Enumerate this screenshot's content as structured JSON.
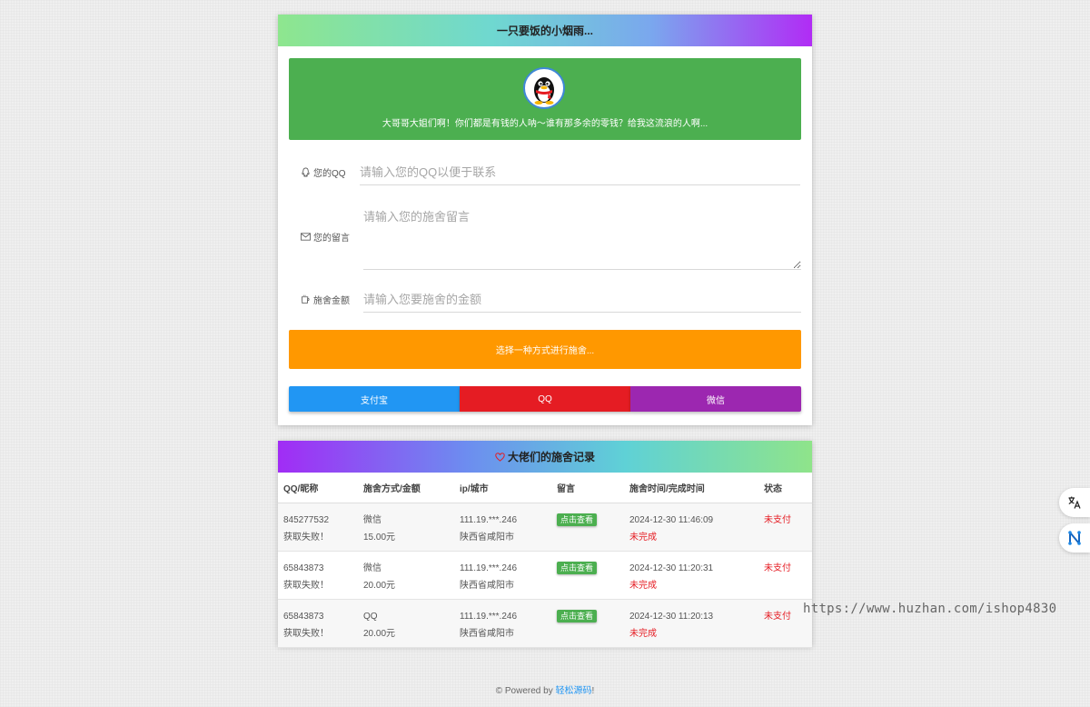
{
  "top_card": {
    "title": "一只要饭的小烟雨...",
    "banner_text": "大哥哥大姐们啊！你们都是有钱的人呐～谁有那多余的零钱？给我这流浪的人啊..."
  },
  "form": {
    "qq_label": "您的QQ",
    "qq_placeholder": "请输入您的QQ以便于联系",
    "message_label": "您的留言",
    "message_placeholder": "请输入您的施舍留言",
    "amount_label": "施舍金额",
    "amount_placeholder": "请输入您要施舍的金额",
    "choose_text": "选择一种方式进行施舍..."
  },
  "payment": {
    "alipay": "支付宝",
    "qq": "QQ",
    "wechat": "微信"
  },
  "records": {
    "title": "大佬们的施舍记录",
    "columns": [
      "QQ/昵称",
      "施舍方式/金额",
      "ip/城市",
      "留言",
      "施舍时间/完成时间",
      "状态"
    ],
    "rows": [
      {
        "qq": "845277532",
        "nick": "获取失败！",
        "method": "微信",
        "amount": "15.00元",
        "ip": "111.19.***.246",
        "city": "陕西省咸阳市",
        "view": "点击查看",
        "time": "2024-12-30 11:46:09",
        "done": "未完成",
        "status": "未支付"
      },
      {
        "qq": "65843873",
        "nick": "获取失败！",
        "method": "微信",
        "amount": "20.00元",
        "ip": "111.19.***.246",
        "city": "陕西省咸阳市",
        "view": "点击查看",
        "time": "2024-12-30 11:20:31",
        "done": "未完成",
        "status": "未支付"
      },
      {
        "qq": "65843873",
        "nick": "获取失败！",
        "method": "QQ",
        "amount": "20.00元",
        "ip": "111.19.***.246",
        "city": "陕西省咸阳市",
        "view": "点击查看",
        "time": "2024-12-30 11:20:13",
        "done": "未完成",
        "status": "未支付"
      }
    ]
  },
  "watermark": "https://www.huzhan.com/ishop4830",
  "footer": {
    "prefix": "© Powered by ",
    "link": "轻松源码",
    "suffix": "!"
  },
  "colors": {
    "banner": "#4caf50",
    "choose": "#ff9800",
    "alipay": "#2196f3",
    "qq": "#e51c23",
    "wechat": "#9c27b0"
  }
}
